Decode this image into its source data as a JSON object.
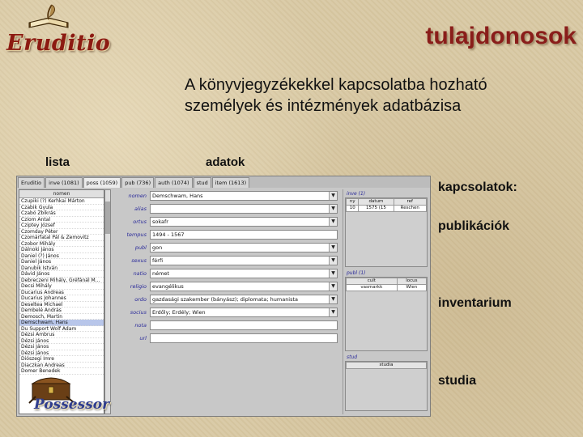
{
  "header": {
    "logo_text": "Eruditio",
    "title": "tulajdonosok",
    "subtitle_line1": "A könyvjegyzékekkel kapcsolatba hozható",
    "subtitle_line2": "személyek és intézmények adatbázisa"
  },
  "sections": {
    "lista": "lista",
    "adatok": "adatok",
    "kapcsolatok": "kapcsolatok:",
    "publikaciok": "publikációk",
    "inventarium": "inventarium",
    "studia": "studia"
  },
  "app": {
    "tabs": [
      {
        "label": "Eruditio"
      },
      {
        "label": "inve (1081)"
      },
      {
        "label": "poss (1059)"
      },
      {
        "label": "pub (736)"
      },
      {
        "label": "auth (1074)"
      },
      {
        "label": "stud"
      },
      {
        "label": "item (1613)"
      }
    ],
    "list": {
      "header": "nomen",
      "items": [
        {
          "name": "Czupiki (?) Kerhkai Márton"
        },
        {
          "name": "Czabik Gyula"
        },
        {
          "name": "Czabó Zbíkrás"
        },
        {
          "name": "Cziom Antal"
        },
        {
          "name": "Cziptey József"
        },
        {
          "name": "Czomday Péter"
        },
        {
          "name": "Czomárfatal Pál & Zemovitz"
        },
        {
          "name": "Czobor Mihály"
        },
        {
          "name": "Dálnoki János"
        },
        {
          "name": "Daniel (?) János"
        },
        {
          "name": "Daniel János"
        },
        {
          "name": "Danubik István"
        },
        {
          "name": "Dávid János"
        },
        {
          "name": "Debreczeni Mihály, Gréfánál M..."
        },
        {
          "name": "Decsi Mihály"
        },
        {
          "name": "Ducarius Andreas"
        },
        {
          "name": "Ducarius Johannes"
        },
        {
          "name": "Deseltea Michael"
        },
        {
          "name": "Dembelé András"
        },
        {
          "name": "Demosch, Martin"
        },
        {
          "name": "Demschwam, Hans"
        },
        {
          "name": "Du Support Wolf Adam"
        },
        {
          "name": "Dézsi Ambrus"
        },
        {
          "name": "Dézsi János"
        },
        {
          "name": "Dézsi János"
        },
        {
          "name": "Dézsi János"
        },
        {
          "name": "Diószegi Imre"
        },
        {
          "name": "Diaczkan Andreas"
        },
        {
          "name": "Domer Benedek"
        }
      ]
    },
    "fields": [
      {
        "label": "nomen",
        "value": "Demschwam, Hans",
        "dropdown": true
      },
      {
        "label": "alias",
        "value": "",
        "dropdown": true
      },
      {
        "label": "ortus",
        "value": "sokafr",
        "dropdown": true
      },
      {
        "label": "tempus",
        "value": "1494 - 1567",
        "dropdown": false
      },
      {
        "label": "publ",
        "value": "gon",
        "dropdown": true
      },
      {
        "label": "sexus",
        "value": "férfi",
        "dropdown": true
      },
      {
        "label": "natio",
        "value": "német",
        "dropdown": true
      },
      {
        "label": "religio",
        "value": "evangélikus",
        "dropdown": true
      },
      {
        "label": "ordo",
        "value": "gazdasági szakember (bányász); diplomata; humanista",
        "dropdown": true
      },
      {
        "label": "socius",
        "value": "Erdőly; Erdély; Wien",
        "dropdown": true
      },
      {
        "label": "nota",
        "value": "",
        "dropdown": false
      },
      {
        "label": "url",
        "value": "",
        "dropdown": false
      }
    ],
    "relations": {
      "inve": {
        "title": "inve (1)",
        "headers": [
          "ny",
          "datum",
          "ref"
        ],
        "rows": [
          [
            "10",
            "1575 (15",
            "Reschen"
          ]
        ]
      },
      "publ": {
        "title": "publ (1)",
        "headers": [
          "cult",
          "locus"
        ],
        "rows": [
          [
            "vasmarkk",
            "Wien"
          ]
        ]
      },
      "stud": {
        "title": "stud",
        "headers": [
          "studia"
        ],
        "rows": []
      }
    }
  },
  "footer": {
    "logo_text": "Possessor"
  },
  "colors": {
    "title": "#8a1d1a",
    "logo_red": "#8c1a12",
    "logo_blue": "#2f3d8e",
    "parchment": "#d9c9a4",
    "field_label": "#2a2a9a",
    "selected_row": "#b8c6ea"
  }
}
